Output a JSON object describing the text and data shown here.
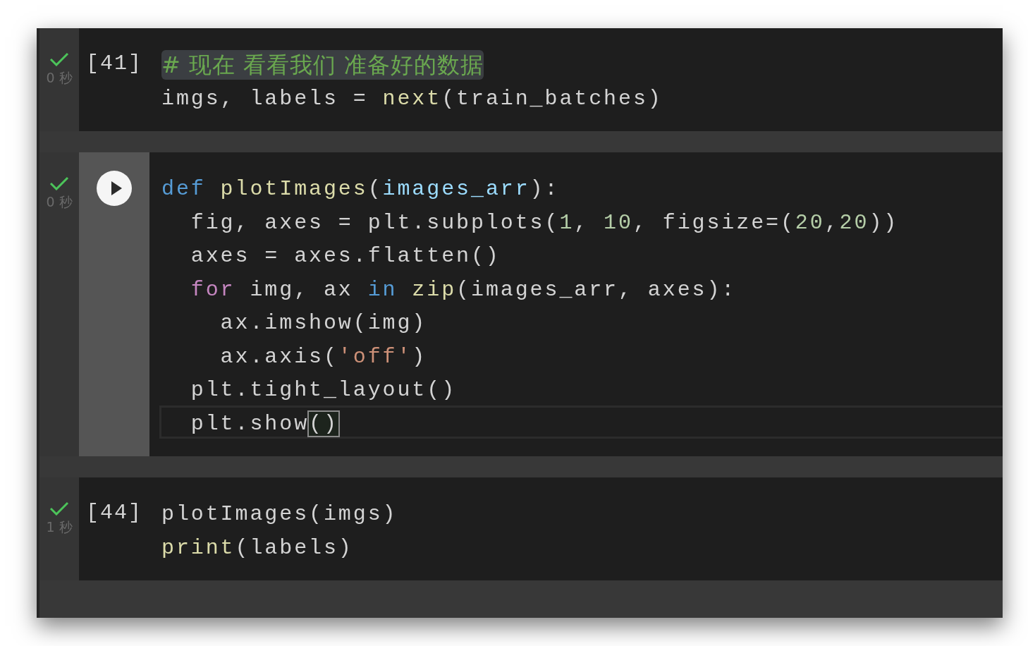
{
  "cells": [
    {
      "kind": "count",
      "prompt": "[41]",
      "done": true,
      "time": "0 秒",
      "lines": [
        {
          "current": false,
          "tokens": [
            {
              "t": "# 现在 看看我们 准备好的数据",
              "kind": "comment",
              "selected": true
            }
          ]
        },
        {
          "current": false,
          "tokens": [
            {
              "t": "imgs, labels = ",
              "kind": "plain"
            },
            {
              "t": "next",
              "kind": "func"
            },
            {
              "t": "(train_batches)",
              "kind": "plain"
            }
          ]
        }
      ]
    },
    {
      "kind": "run",
      "done": true,
      "time": "0 秒",
      "lines": [
        {
          "current": false,
          "tokens": [
            {
              "t": "def",
              "kind": "def"
            },
            {
              "t": " plotImages",
              "kind": "func"
            },
            {
              "t": "(",
              "kind": "plain"
            },
            {
              "t": "images_arr",
              "kind": "param"
            },
            {
              "t": "):",
              "kind": "plain"
            }
          ]
        },
        {
          "current": false,
          "tokens": [
            {
              "t": "  fig, axes = plt.subplots(",
              "kind": "plain"
            },
            {
              "t": "1",
              "kind": "number"
            },
            {
              "t": ", ",
              "kind": "plain"
            },
            {
              "t": "10",
              "kind": "number"
            },
            {
              "t": ", figsize=(",
              "kind": "plain"
            },
            {
              "t": "20",
              "kind": "number"
            },
            {
              "t": ",",
              "kind": "plain"
            },
            {
              "t": "20",
              "kind": "number"
            },
            {
              "t": "))",
              "kind": "plain"
            }
          ]
        },
        {
          "current": false,
          "tokens": [
            {
              "t": "  axes = axes.flatten()",
              "kind": "plain"
            }
          ]
        },
        {
          "current": false,
          "tokens": [
            {
              "t": "  for",
              "kind": "keyword"
            },
            {
              "t": " img, ax ",
              "kind": "plain"
            },
            {
              "t": "in",
              "kind": "def"
            },
            {
              "t": " zip",
              "kind": "func"
            },
            {
              "t": "(images_arr, axes):",
              "kind": "plain"
            }
          ]
        },
        {
          "current": false,
          "tokens": [
            {
              "t": "    ax.imshow(img)",
              "kind": "plain"
            }
          ]
        },
        {
          "current": false,
          "tokens": [
            {
              "t": "    ax.axis(",
              "kind": "plain"
            },
            {
              "t": "'off'",
              "kind": "string"
            },
            {
              "t": ")",
              "kind": "plain"
            }
          ]
        },
        {
          "current": false,
          "tokens": [
            {
              "t": "  plt.tight_layout()",
              "kind": "plain"
            }
          ]
        },
        {
          "current": true,
          "tokens": [
            {
              "t": "  plt.show",
              "kind": "plain"
            },
            {
              "t": "()",
              "kind": "plain",
              "matched": true
            }
          ]
        }
      ]
    },
    {
      "kind": "count",
      "prompt": "[44]",
      "done": true,
      "time": "1 秒",
      "lines": [
        {
          "current": false,
          "tokens": [
            {
              "t": "plotImages(imgs)",
              "kind": "plain"
            }
          ]
        },
        {
          "current": false,
          "tokens": [
            {
              "t": "print",
              "kind": "func"
            },
            {
              "t": "(labels)",
              "kind": "plain"
            }
          ]
        }
      ]
    }
  ]
}
